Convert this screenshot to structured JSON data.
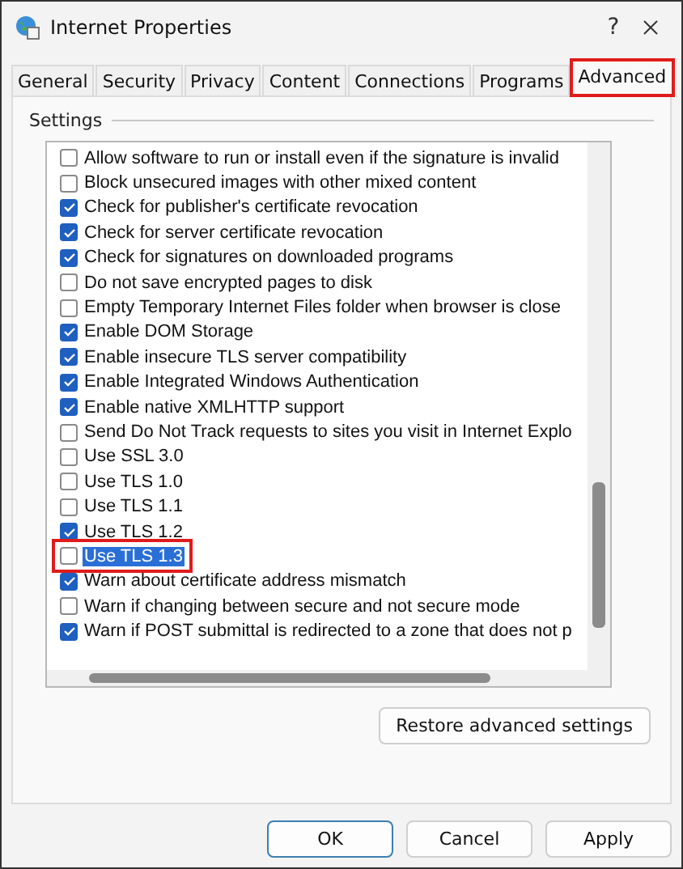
{
  "window": {
    "title": "Internet Properties",
    "help": "?"
  },
  "tabs": [
    {
      "label": "General",
      "selected": false,
      "highlighted": false
    },
    {
      "label": "Security",
      "selected": false,
      "highlighted": false
    },
    {
      "label": "Privacy",
      "selected": false,
      "highlighted": false
    },
    {
      "label": "Content",
      "selected": false,
      "highlighted": false
    },
    {
      "label": "Connections",
      "selected": false,
      "highlighted": false
    },
    {
      "label": "Programs",
      "selected": false,
      "highlighted": false
    },
    {
      "label": "Advanced",
      "selected": true,
      "highlighted": true
    }
  ],
  "settings": {
    "label": "Settings",
    "items": [
      {
        "label": "Allow software to run or install even if the signature is invalid",
        "checked": false,
        "selected": false,
        "highlighted": false
      },
      {
        "label": "Block unsecured images with other mixed content",
        "checked": false,
        "selected": false,
        "highlighted": false
      },
      {
        "label": "Check for publisher's certificate revocation",
        "checked": true,
        "selected": false,
        "highlighted": false
      },
      {
        "label": "Check for server certificate revocation",
        "checked": true,
        "selected": false,
        "highlighted": false
      },
      {
        "label": "Check for signatures on downloaded programs",
        "checked": true,
        "selected": false,
        "highlighted": false
      },
      {
        "label": "Do not save encrypted pages to disk",
        "checked": false,
        "selected": false,
        "highlighted": false
      },
      {
        "label": "Empty Temporary Internet Files folder when browser is close",
        "checked": false,
        "selected": false,
        "highlighted": false
      },
      {
        "label": "Enable DOM Storage",
        "checked": true,
        "selected": false,
        "highlighted": false
      },
      {
        "label": "Enable insecure TLS server compatibility",
        "checked": true,
        "selected": false,
        "highlighted": false
      },
      {
        "label": "Enable Integrated Windows Authentication",
        "checked": true,
        "selected": false,
        "highlighted": false
      },
      {
        "label": "Enable native XMLHTTP support",
        "checked": true,
        "selected": false,
        "highlighted": false
      },
      {
        "label": "Send Do Not Track requests to sites you visit in Internet Explo",
        "checked": false,
        "selected": false,
        "highlighted": false
      },
      {
        "label": "Use SSL 3.0",
        "checked": false,
        "selected": false,
        "highlighted": false
      },
      {
        "label": "Use TLS 1.0",
        "checked": false,
        "selected": false,
        "highlighted": false
      },
      {
        "label": "Use TLS 1.1",
        "checked": false,
        "selected": false,
        "highlighted": false
      },
      {
        "label": "Use TLS 1.2",
        "checked": true,
        "selected": false,
        "highlighted": false
      },
      {
        "label": "Use TLS 1.3",
        "checked": false,
        "selected": true,
        "highlighted": true
      },
      {
        "label": "Warn about certificate address mismatch",
        "checked": true,
        "selected": false,
        "highlighted": false
      },
      {
        "label": "Warn if changing between secure and not secure mode",
        "checked": false,
        "selected": false,
        "highlighted": false
      },
      {
        "label": "Warn if POST submittal is redirected to a zone that does not p",
        "checked": true,
        "selected": false,
        "highlighted": false
      }
    ]
  },
  "restore_button": "Restore advanced settings",
  "buttons": [
    {
      "label": "OK",
      "default": true
    },
    {
      "label": "Cancel",
      "default": false
    },
    {
      "label": "Apply",
      "default": false
    }
  ]
}
